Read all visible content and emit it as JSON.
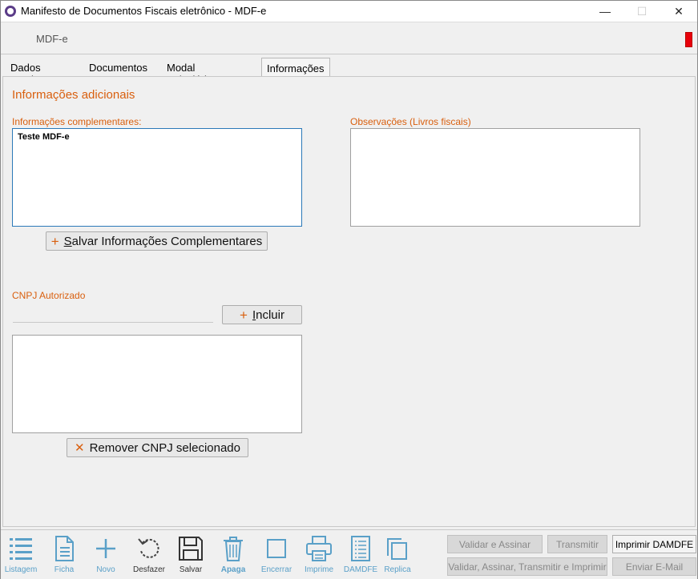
{
  "window": {
    "title": "Manifesto de Documentos Fiscais eletrônico - MDF-e",
    "minimize_glyph": "—",
    "maximize_glyph": "☐",
    "close_glyph": "✕"
  },
  "header": {
    "title": "MDF-e",
    "indicator_color": "#e8000b"
  },
  "tabs": [
    {
      "label": "Dados gerais"
    },
    {
      "label": "Documentos"
    },
    {
      "label": "Modal rodoviário"
    },
    {
      "label": "Informações Adicionais",
      "active": true
    }
  ],
  "section": {
    "title": "Informações adicionais"
  },
  "complementares": {
    "label": "Informações complementares:",
    "value": "Teste MDF-e",
    "save_button": "Salvar Informações Complementares",
    "save_button_mnemonic": "S",
    "save_button_rest": "alvar Informações Complementares"
  },
  "observacoes": {
    "label": "Observações (Livros fiscais)",
    "value": ""
  },
  "cnpj": {
    "label": "CNPJ Autorizado",
    "input_value": "",
    "include_button_mnemonic": "I",
    "include_button_rest": "ncluir",
    "remove_button": "Remover CNPJ selecionado",
    "list_items": []
  },
  "toolbar": {
    "items": [
      {
        "label": "Listagem",
        "icon": "list-icon"
      },
      {
        "label": "Ficha",
        "icon": "document-icon"
      },
      {
        "label": "Novo",
        "icon": "plus-icon"
      },
      {
        "label": "Desfazer",
        "icon": "undo-icon"
      },
      {
        "label": "Salvar",
        "icon": "floppy-icon"
      },
      {
        "label": "Apaga",
        "icon": "trash-icon"
      },
      {
        "label": "Encerrar",
        "icon": "square-icon"
      },
      {
        "label": "Imprime",
        "icon": "printer-icon"
      },
      {
        "label": "DAMDFE",
        "icon": "report-icon"
      },
      {
        "label": "Replica",
        "icon": "copy-icon"
      }
    ]
  },
  "actions": {
    "validar_assinar": "Validar e Assinar",
    "transmitir": "Transmitir",
    "imprimir_damdfe": "Imprimir DAMDFE",
    "validar_assinar_transmitir_imprimir": "Validar, Assinar, Transmitir e Imprimir",
    "enviar_email": "Enviar E-Mail"
  },
  "colors": {
    "accent": "#d95f0e",
    "toolbar_icon": "#5aa0c8",
    "focus_border": "#2b79b8"
  }
}
